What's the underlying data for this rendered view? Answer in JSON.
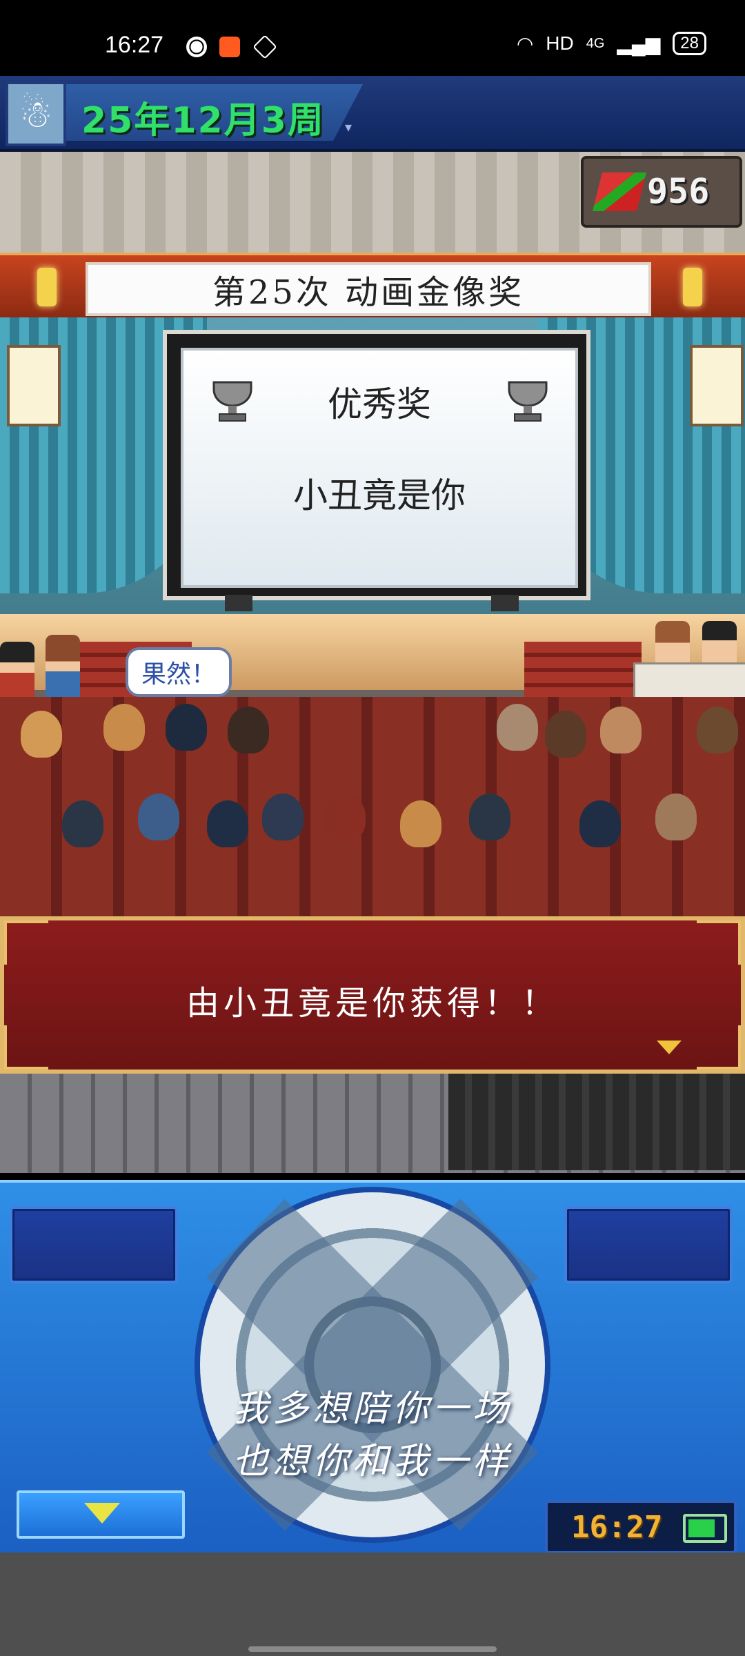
{
  "status_bar": {
    "time": "16:27",
    "network": "HD",
    "signal": "4G",
    "battery": "28"
  },
  "top_bar": {
    "date": "25年12月3周"
  },
  "money": {
    "value": "956",
    "icon": "money-stack-icon"
  },
  "award": {
    "banner_title": "第25次 动画金像奖",
    "category": "优秀奖",
    "winner": "小丑竟是你"
  },
  "speech_bubble": {
    "text": "果然！"
  },
  "dialog": {
    "message": "由小丑竟是你获得！！"
  },
  "lyrics": {
    "line1": "我多想陪你一场",
    "line2": "也想你和我一样"
  },
  "controller": {
    "clock": "16:27"
  }
}
